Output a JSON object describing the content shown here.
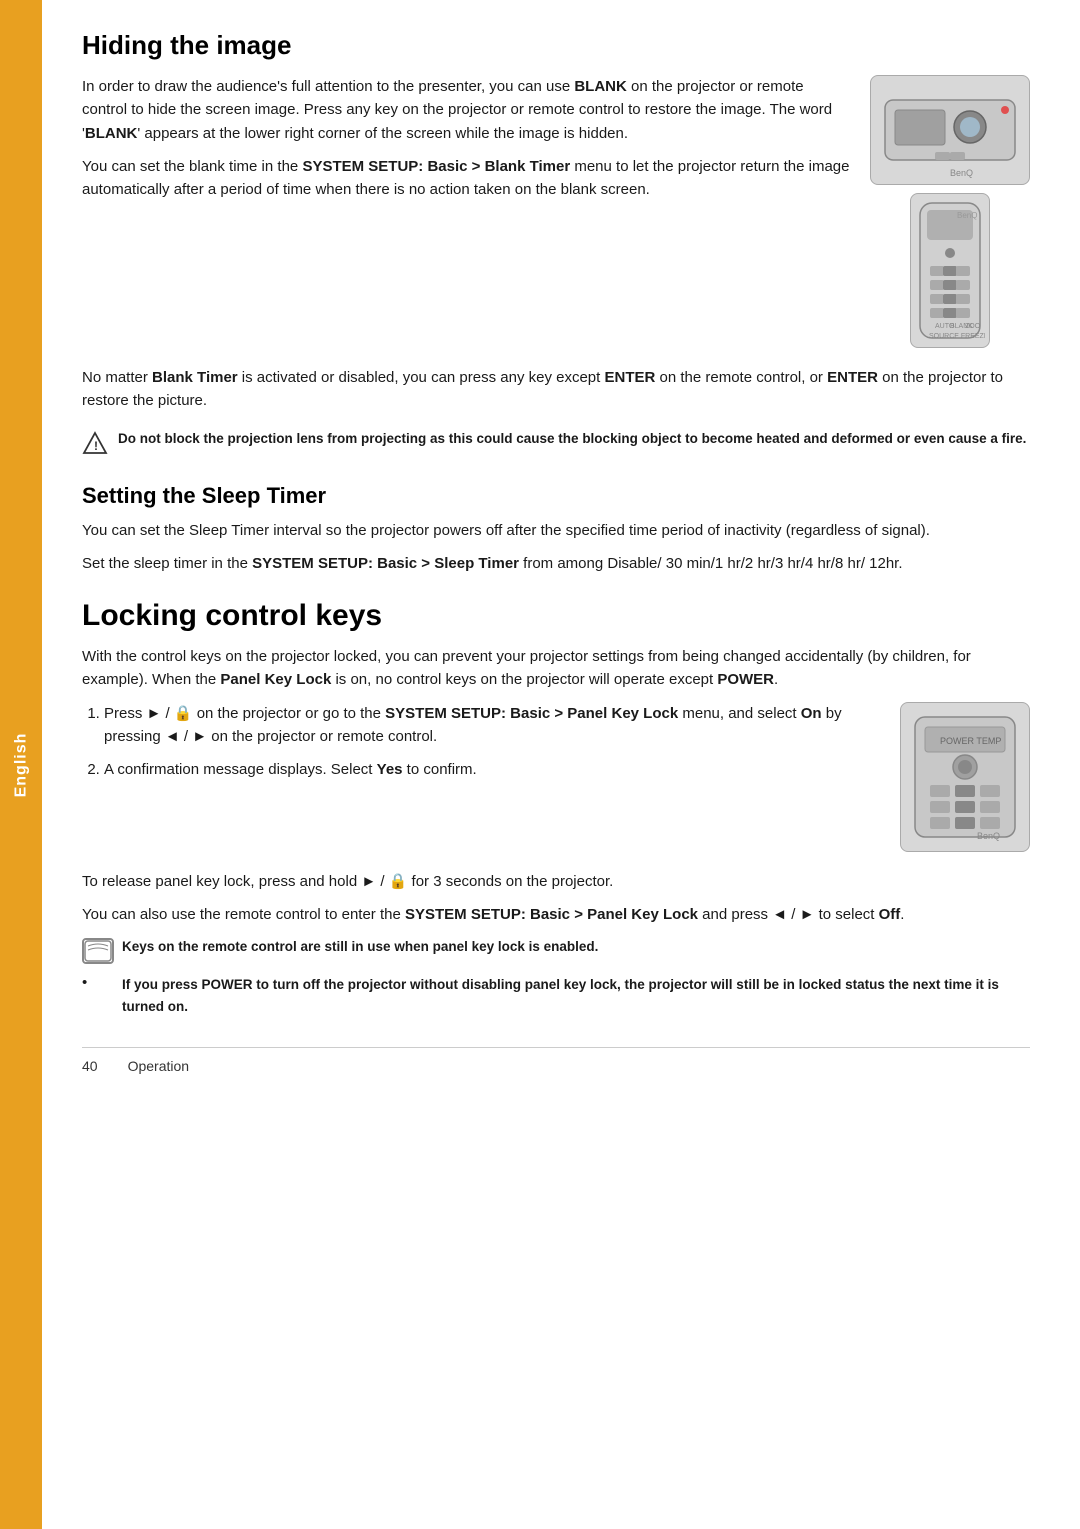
{
  "sidebar": {
    "label": "English"
  },
  "section1": {
    "title": "Hiding the image",
    "para1": "In order to draw the audience's full attention to the presenter, you can use ",
    "para1_bold1": "BLANK",
    "para1_cont": " on the projector or remote control to hide the screen image. Press any key on the projector or remote control to restore the image. The word '",
    "para1_bold2": "BLANK",
    "para1_cont2": "' appears at the lower right corner of the screen while the image is hidden.",
    "para2_intro": "You can set the blank time in the ",
    "para2_bold1": "SYSTEM SETUP: Basic > Blank Timer",
    "para2_cont": " menu to let the projector return the image automatically after a period of time when there is no action taken on the blank screen.",
    "para3_intro": "No matter ",
    "para3_bold1": "Blank Timer",
    "para3_cont": " is activated or disabled, you can press any key except ",
    "para3_bold2": "ENTER",
    "para3_cont2": " on the remote control, or ",
    "para3_bold3": "ENTER",
    "para3_cont3": " on the projector to restore the picture.",
    "warning": "Do not block the projection lens from projecting as this could cause the blocking object to become heated and deformed or even cause a fire."
  },
  "section2": {
    "title": "Setting the Sleep Timer",
    "para1": "You can set the Sleep Timer interval so the projector powers off after the specified time period of inactivity (regardless of signal).",
    "para2_intro": "Set the sleep timer in the ",
    "para2_bold": "SYSTEM SETUP: Basic > Sleep Timer",
    "para2_cont": " from among Disable/ 30 min/1 hr/2 hr/3 hr/4 hr/8 hr/ 12hr."
  },
  "section3": {
    "title": "Locking control keys",
    "para1": "With the control keys on the projector locked, you can prevent your projector settings from being changed accidentally (by children, for example). When the ",
    "para1_bold1": "Panel Key Lock",
    "para1_cont": " is on, no control keys on the projector will operate except ",
    "para1_bold2": "POWER",
    "para1_end": ".",
    "step1_intro": "Press ▶ / 🔒 on the projector or go to the ",
    "step1_bold1": "SYSTEM SETUP: Basic > Panel Key Lock",
    "step1_cont": " menu, and select ",
    "step1_bold2": "On",
    "step1_cont2": " by pressing ◀ / ▶ on the projector or remote control.",
    "step2": "A confirmation message displays. Select ",
    "step2_bold": "Yes",
    "step2_cont": " to confirm.",
    "para_release_intro": "To release panel key lock, press and hold ▶ / 🔒 for 3 seconds on the projector.",
    "para_also_intro": "You can also use the remote control to enter the ",
    "para_also_bold1": "SYSTEM SETUP: Basic > Panel Key",
    "para_also_cont": " Lock and press ◀ / ▶ to select ",
    "para_also_bold2": "Off",
    "para_also_end": ".",
    "note1_bold": "Keys on the remote control are still in use when panel key lock is enabled.",
    "note2_bold": "If you press POWER to turn off the projector without disabling panel key lock, the projector will still be in locked status the next time it is turned on."
  },
  "footer": {
    "page": "40",
    "section": "Operation"
  }
}
